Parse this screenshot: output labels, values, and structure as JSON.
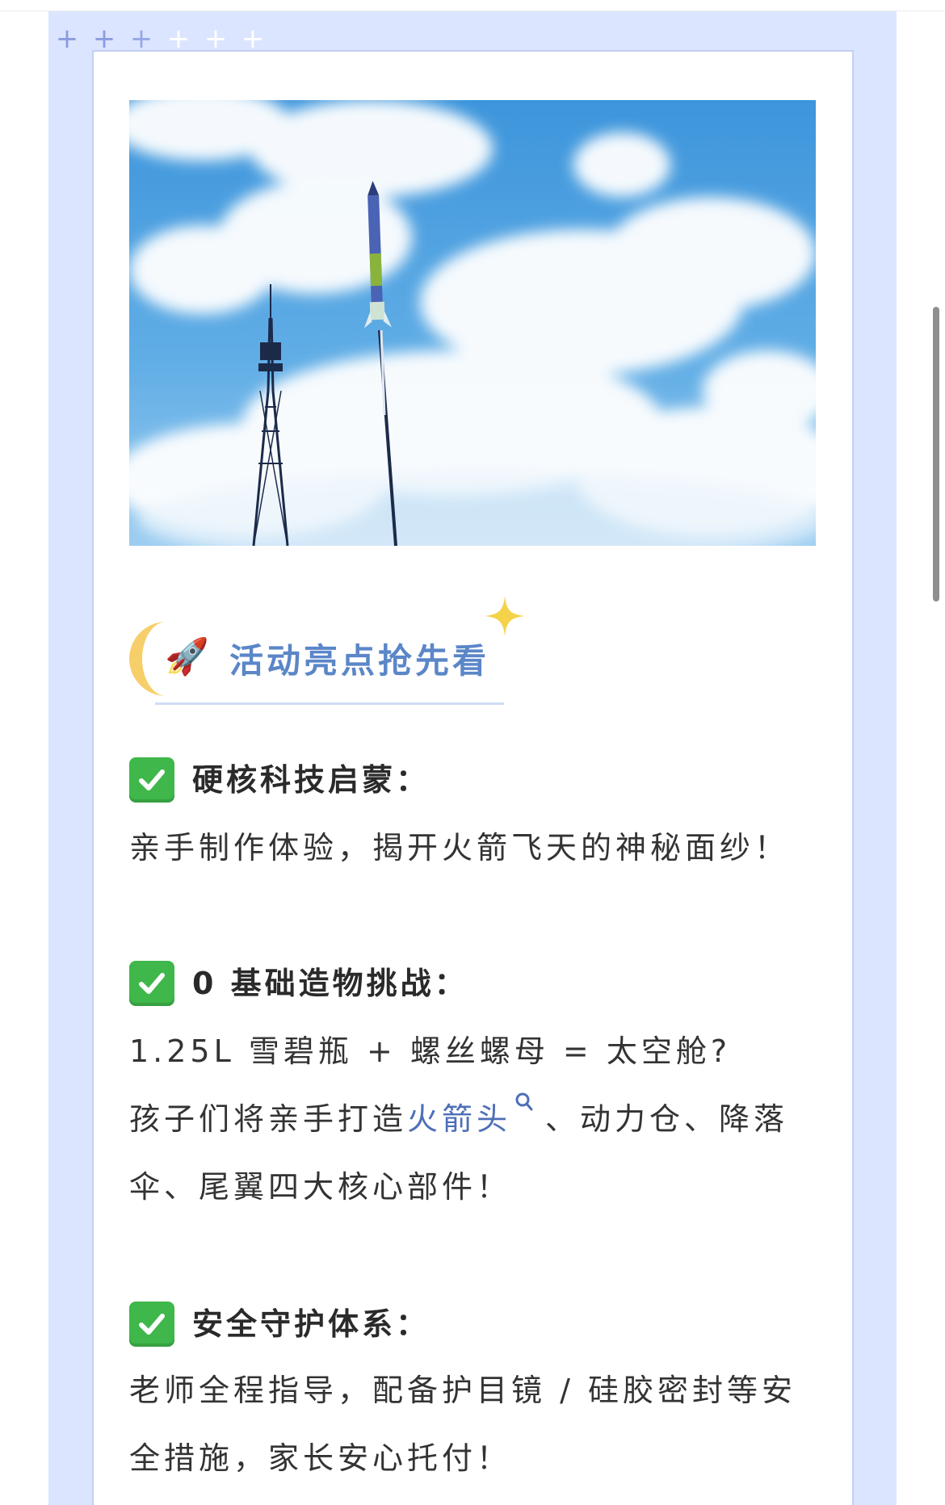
{
  "decor": {
    "plus_signs": [
      "+",
      "+",
      "+",
      "+",
      "+",
      "+"
    ]
  },
  "heading": {
    "emoji": "🚀",
    "title": "活动亮点抢先看"
  },
  "sections": [
    {
      "title": "硬核科技启蒙：",
      "paragraphs": [
        "亲手制作体验，揭开火箭飞天的神秘面纱！"
      ]
    },
    {
      "title": "0 基础造物挑战：",
      "line1": "1.25L 雪碧瓶 + 螺丝螺母 = 太空舱?",
      "line2_before": "孩子们将亲手打造",
      "line2_link": "火箭头",
      "line2_after": "、动力仓、降落",
      "line3": "伞、尾翼四大核心部件！"
    },
    {
      "title": "安全守护体系：",
      "line1": "老师全程指导，配备护目镜 / 硅胶密封等安",
      "line2": "全措施，家长安心托付！"
    }
  ],
  "colors": {
    "frame": "#dce5ff",
    "card_border": "#c3cff5",
    "heading_text": "#5b86c8",
    "link_text": "#4d6fb7",
    "check_green": "#3fb74a",
    "moon": "#f7cf6a",
    "sparkle": "#f4d24a"
  },
  "icons": [
    "plus-icon",
    "moon-icon",
    "rocket-icon",
    "sparkle-icon",
    "check-mark-icon",
    "search-icon"
  ]
}
